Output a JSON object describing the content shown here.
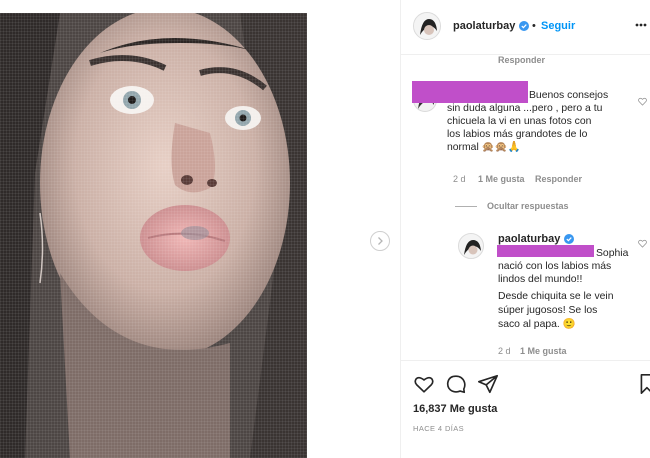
{
  "post": {
    "username": "paolaturbay",
    "separator": "•",
    "follow_label": "Seguir",
    "likes": "16,837 Me gusta",
    "time_ago": "HACE 4 DÍAS"
  },
  "comments": {
    "top_partial_reply": "Responder",
    "comment1": {
      "lines": [
        "Buenos consejos",
        "sin duda alguna ...pero , pero a tu",
        "chicuela la vi en unas fotos con",
        "los labios más grandotes de lo",
        "normal 🙊🙊🙏"
      ],
      "time": "2 d",
      "likes": "1 Me gusta",
      "reply": "Responder"
    },
    "hide_replies": "Ocultar respuestas",
    "reply1": {
      "username": "paolaturbay",
      "lines": [
        "Sophia",
        "nació con los labios más",
        "lindos del mundo!!",
        "Desde chiquita se le vein",
        "súper jugosos! Se los",
        "saco al papa. 🙂"
      ],
      "time": "2 d",
      "likes": "1 Me gusta"
    }
  },
  "colors": {
    "verified": "#3897f0",
    "follow": "#0095f6",
    "redaction": "#c04fc9",
    "meta": "#8e8e8e"
  }
}
